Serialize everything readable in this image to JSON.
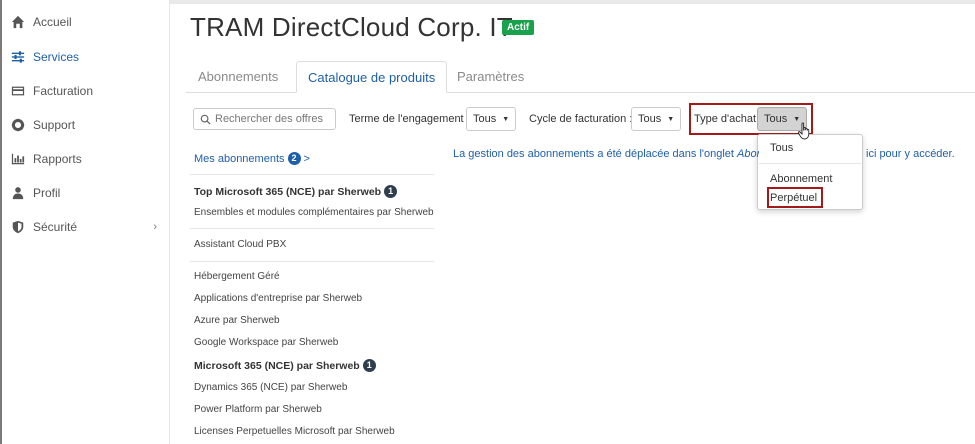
{
  "sidebar": {
    "items": [
      {
        "label": "Accueil",
        "icon": "home-icon"
      },
      {
        "label": "Services",
        "icon": "sliders-icon"
      },
      {
        "label": "Facturation",
        "icon": "credit-card-icon"
      },
      {
        "label": "Support",
        "icon": "lifebuoy-icon"
      },
      {
        "label": "Rapports",
        "icon": "bar-chart-icon"
      },
      {
        "label": "Profil",
        "icon": "user-icon"
      },
      {
        "label": "Sécurité",
        "icon": "shield-icon",
        "chevron": "›"
      }
    ]
  },
  "header": {
    "title": "TRAM DirectCloud Corp. IT",
    "status_badge": "Actif"
  },
  "tabs": [
    {
      "label": "Abonnements"
    },
    {
      "label": "Catalogue de produits"
    },
    {
      "label": "Paramètres"
    }
  ],
  "filters": {
    "search_placeholder": "Rechercher des offres",
    "engagement_label": "Terme de l'engagement :",
    "engagement_value": "Tous",
    "billing_label": "Cycle de facturation :",
    "billing_value": "Tous",
    "purchase_label": "Type d'achat:",
    "purchase_value": "Tous"
  },
  "purchase_menu": {
    "options": [
      "Tous",
      "Abonnement",
      "Perpétuel"
    ]
  },
  "catalog": {
    "my_subscriptions_label": "Mes abonnements",
    "my_subscriptions_count": "2",
    "my_subscriptions_arrow": ">",
    "items": [
      {
        "label": "Top Microsoft 365 (NCE) par Sherweb",
        "count": "1"
      },
      {
        "label": "Ensembles et modules complémentaires par Sherweb"
      },
      {
        "label": "Assistant Cloud PBX"
      },
      {
        "label": "Hébergement Géré"
      },
      {
        "label": "Applications d'entreprise par Sherweb"
      },
      {
        "label": "Azure par Sherweb"
      },
      {
        "label": "Google Workspace par Sherweb"
      },
      {
        "label": "Microsoft 365 (NCE) par Sherweb",
        "count": "1"
      },
      {
        "label": "Dynamics 365 (NCE) par Sherweb"
      },
      {
        "label": "Power Platform par Sherweb"
      },
      {
        "label": "Licenses Perpetuelles Microsoft par Sherweb"
      }
    ]
  },
  "info": {
    "message_start": "La gestion des abonnements a été déplacée dans l'onglet ",
    "message_em": "Abonnements",
    "message_tail": "ici pour y accéder."
  },
  "colors": {
    "accent": "#1f5fa8",
    "active_badge": "#1aa14b",
    "highlight": "#a31a1a"
  }
}
